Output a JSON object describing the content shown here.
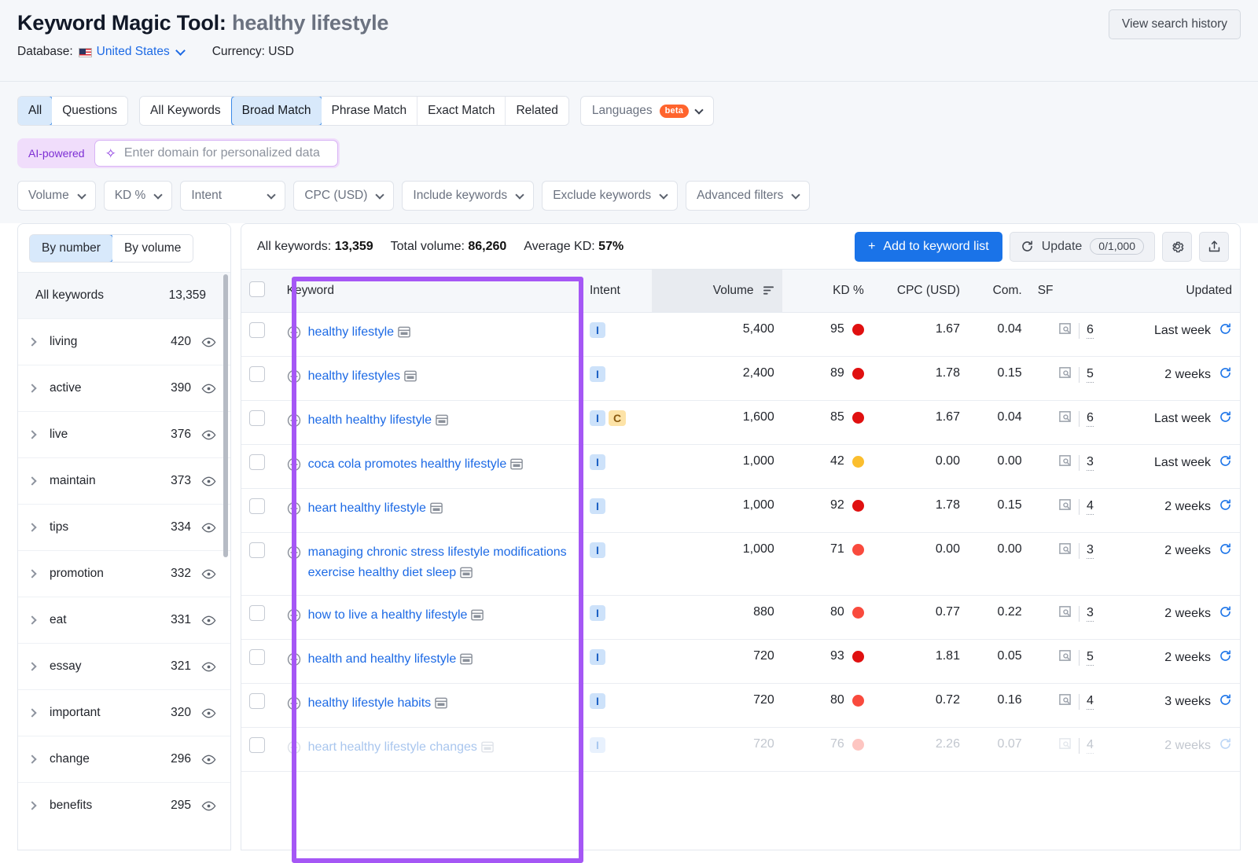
{
  "header": {
    "title_prefix": "Keyword Magic Tool:",
    "query": "healthy lifestyle",
    "database_label": "Database:",
    "database_value": "United States",
    "currency_label": "Currency: USD",
    "view_history_label": "View search history"
  },
  "tabs": {
    "group1": [
      "All",
      "Questions"
    ],
    "group2": [
      "All Keywords",
      "Broad Match",
      "Phrase Match",
      "Exact Match",
      "Related"
    ],
    "active": "Broad Match",
    "active_group1": "All",
    "languages_label": "Languages",
    "languages_badge": "beta"
  },
  "ai_row": {
    "tag": "AI-powered",
    "placeholder": "Enter domain for personalized data"
  },
  "filters": [
    {
      "label": "Volume"
    },
    {
      "label": "KD %"
    },
    {
      "label": "Intent"
    },
    {
      "label": "CPC (USD)"
    },
    {
      "label": "Include keywords"
    },
    {
      "label": "Exclude keywords"
    },
    {
      "label": "Advanced filters"
    }
  ],
  "sidebar": {
    "toggle": {
      "by_number": "By number",
      "by_volume": "By volume",
      "active": "By number"
    },
    "all_keywords": {
      "label": "All keywords",
      "count": "13,359"
    },
    "groups": [
      {
        "label": "living",
        "count": "420"
      },
      {
        "label": "active",
        "count": "390"
      },
      {
        "label": "live",
        "count": "376"
      },
      {
        "label": "maintain",
        "count": "373"
      },
      {
        "label": "tips",
        "count": "334"
      },
      {
        "label": "promotion",
        "count": "332"
      },
      {
        "label": "eat",
        "count": "331"
      },
      {
        "label": "essay",
        "count": "321"
      },
      {
        "label": "important",
        "count": "320"
      },
      {
        "label": "change",
        "count": "296"
      },
      {
        "label": "benefits",
        "count": "295"
      }
    ]
  },
  "toolbar": {
    "all_keywords_label": "All keywords:",
    "all_keywords_value": "13,359",
    "total_volume_label": "Total volume:",
    "total_volume_value": "86,260",
    "average_kd_label": "Average KD:",
    "average_kd_value": "57%",
    "add_to_list_label": "Add to keyword list",
    "update_label": "Update",
    "update_quota": "0/1,000"
  },
  "table": {
    "columns": [
      "Keyword",
      "Intent",
      "Volume",
      "KD %",
      "CPC (USD)",
      "Com.",
      "SF",
      "Updated"
    ],
    "sorted_column": "Volume",
    "rows": [
      {
        "keyword": "healthy lifestyle",
        "intent": [
          "I"
        ],
        "volume": "5,400",
        "kd": "95",
        "kd_color": "#e01010",
        "cpc": "1.67",
        "com": "0.04",
        "sf": "6",
        "updated": "Last week"
      },
      {
        "keyword": "healthy lifestyles",
        "intent": [
          "I"
        ],
        "volume": "2,400",
        "kd": "89",
        "kd_color": "#e01010",
        "cpc": "1.78",
        "com": "0.15",
        "sf": "5",
        "updated": "2 weeks"
      },
      {
        "keyword": "health healthy lifestyle",
        "intent": [
          "I",
          "C"
        ],
        "volume": "1,600",
        "kd": "85",
        "kd_color": "#e01010",
        "cpc": "1.67",
        "com": "0.04",
        "sf": "6",
        "updated": "Last week"
      },
      {
        "keyword": "coca cola promotes healthy lifestyle",
        "intent": [
          "I"
        ],
        "volume": "1,000",
        "kd": "42",
        "kd_color": "#fbbe2e",
        "cpc": "0.00",
        "com": "0.00",
        "sf": "3",
        "updated": "Last week"
      },
      {
        "keyword": "heart healthy lifestyle",
        "intent": [
          "I"
        ],
        "volume": "1,000",
        "kd": "92",
        "kd_color": "#e01010",
        "cpc": "1.78",
        "com": "0.15",
        "sf": "4",
        "updated": "2 weeks"
      },
      {
        "keyword": "managing chronic stress lifestyle modifications exercise healthy diet sleep",
        "intent": [
          "I"
        ],
        "volume": "1,000",
        "kd": "71",
        "kd_color": "#f94a3d",
        "cpc": "0.00",
        "com": "0.00",
        "sf": "3",
        "updated": "2 weeks"
      },
      {
        "keyword": "how to live a healthy lifestyle",
        "intent": [
          "I"
        ],
        "volume": "880",
        "kd": "80",
        "kd_color": "#f94a3d",
        "cpc": "0.77",
        "com": "0.22",
        "sf": "3",
        "updated": "2 weeks"
      },
      {
        "keyword": "health and healthy lifestyle",
        "intent": [
          "I"
        ],
        "volume": "720",
        "kd": "93",
        "kd_color": "#e01010",
        "cpc": "1.81",
        "com": "0.05",
        "sf": "5",
        "updated": "2 weeks"
      },
      {
        "keyword": "healthy lifestyle habits",
        "intent": [
          "I"
        ],
        "volume": "720",
        "kd": "80",
        "kd_color": "#f94a3d",
        "cpc": "0.72",
        "com": "0.16",
        "sf": "4",
        "updated": "3 weeks"
      },
      {
        "keyword": "heart healthy lifestyle changes",
        "intent": [
          "I"
        ],
        "volume": "720",
        "kd": "76",
        "kd_color": "#f94a3d",
        "cpc": "2.26",
        "com": "0.07",
        "sf": "4",
        "updated": "2 weeks",
        "faded": true
      }
    ]
  },
  "colors": {
    "accent_blue": "#1a73e8",
    "link_blue": "#1d6ae5",
    "highlight_purple": "#a557f5",
    "beta_orange": "#ff642d"
  }
}
